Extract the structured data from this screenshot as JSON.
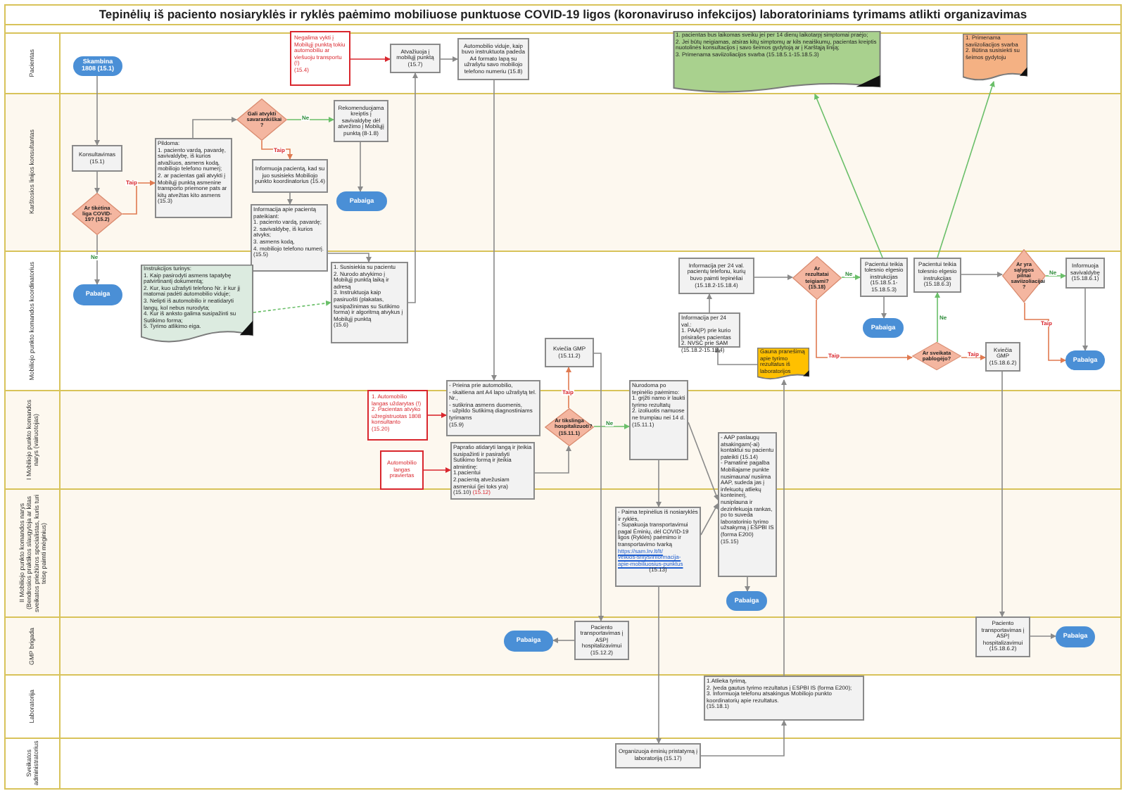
{
  "title": "Tepinėlių iš paciento nosiaryklės ir ryklės paėmimo mobiliuose punktuose COVID-19 ligos (koronaviruso infekcijos) laboratoriniams tyrimams atlikti organizavimas",
  "lanes": [
    {
      "label": "Pacientas"
    },
    {
      "label": "Karštosios linijos konsultantas"
    },
    {
      "label": "Mobiliojo punkto komandos koordinatorius"
    },
    {
      "label": "I Mobiliojo punkto komandos narys (vairuotojas)"
    },
    {
      "label": "II Mobiliojo punkto komandos narys (Bendrosios praktikos slaugytoja ar kitas sveikatos priežiūros specialistas, kuris turi teisę paimti mėginius)"
    },
    {
      "label": "GMP brigada"
    },
    {
      "label": "Laboratorija"
    },
    {
      "label": "Sveikatos administratorius"
    }
  ],
  "nodes": [
    {
      "kind": "start",
      "text": "Skambina 1808 (15.1)"
    },
    {
      "kind": "alert",
      "text": "Negalima vykti į Mobilųjį punktą tokiu automobiliu ar viešuoju transportu (!)\n(15.4)"
    },
    {
      "kind": "process",
      "text": "Atvažiuoja į mobilųjį punktą (15.7)"
    },
    {
      "kind": "process",
      "text": "Automobilio viduje, kaip buvo instruktuota padeda A4 formato lapą su užrašytu savo mobiliojo telefono numeriu (15.8)"
    },
    {
      "kind": "document",
      "color": "#a9d18e",
      "text": "1. pacientas bus laikomas sveiku jei per 14 dienų laikotarpį simptomai praėjo;\n2. Jei būtų neigiamas, atsiras kitų simptomų ar kils neaiškumų, pacientas kreiptis nuotolinės konsultacijos į savo šeimos gydytoją ar į Karštąją liniją;\n3. Primenama saviizoliacijos svarba (15.18.5.1-15.18.5.3)"
    },
    {
      "kind": "document",
      "color": "#f4b183",
      "text": "1. Primenama saviizoliacijos svarba\n2. Būtina susisiekti su šeimos gydytoju"
    },
    {
      "kind": "process",
      "text": "Konsultavimas (15.1)"
    },
    {
      "kind": "decision",
      "text": "Ar tikėtina liga COVID-19? (15.2)"
    },
    {
      "kind": "process",
      "text": "Pildoma:\n1. paciento vardą, pavardę, savivaldybę, iš kurios atvažiuos, asmens kodą, mobiliojo telefono numerį;\n2. ar pacientas gali atvykti į Mobilųjį punktą asmenine transporto priemone pats ar kitų atvežtas kito asmens\n(15.3)"
    },
    {
      "kind": "decision",
      "text": "Gali atvykti savarankiškai ?"
    },
    {
      "kind": "process",
      "text": "Rekomenduojama kreiptis į savivaldybę dėl atvežimo į Mobilųjį punktą (8-1.8)"
    },
    {
      "kind": "process",
      "text": "Informuoja pacientą, kad su juo susisieks Mobiliojo punkto koordinatorius (15.4)"
    },
    {
      "kind": "end",
      "text": "Pabaiga"
    },
    {
      "kind": "process",
      "text": "Informacija apie pacientą pateikiant:\n1. paciento vardą, pavardę;\n2. savivaldybę, iš kurios atvyks;\n3. asmens kodą,\n4. mobiliojo telefono numerį.\n(15.5)"
    },
    {
      "kind": "end",
      "text": "Pabaiga"
    },
    {
      "kind": "document",
      "color": "#dcebe0",
      "text": "Instrukcijos turinys:\n1. Kaip pasirodyti asmens tapatybę patvirtinantį dokumentą;\n2. Kur, kuo užrašyti telefono Nr. ir kur jį matomai padėti automobilio viduje;\n3. Nelipti iš automobilio ir neatidaryti langų, kol nebus nurodyta;\n4. Kur iš anksto galima susipažinti su Sutikimo forma;\n5. Tyrimo atlikimo eiga."
    },
    {
      "kind": "process",
      "text": "1. Susisiekia su pacientu\n2. Nurodo atvykimo į Mobilųjį punktą laiką ir adresą\n3. Instruktuoja kaip pasiruošti (plakatas, susipažinimas su Sutikimo forma) ir algoritmą atvykus į Mobilųjį punktą\n(15.6)"
    },
    {
      "kind": "process",
      "text": "Informacija per 24 val. pacientų telefonu, kurių buvo paimti tepinėliai (15.18.2-15.18.4)"
    },
    {
      "kind": "process",
      "text": "Informacija per 24 val.:\n1. PAA(P) prie kurio prisirašęs pacientas\n2. NVSC prie SAM\n(15.18.2-15.18.4)"
    },
    {
      "kind": "process",
      "text": "Kviečia GMP (15.11.2)"
    },
    {
      "kind": "decision",
      "text": "Ar rezultatai teigiami? (15.18)"
    },
    {
      "kind": "process",
      "text": "Pacientui teikia tolesnio elgesio instrukcijas (15.18.5.1-15.18.5.3)"
    },
    {
      "kind": "end",
      "text": "Pabaiga"
    },
    {
      "kind": "process",
      "text": "Pacientui teikia tolesnio elgesio instrukcijas (15.18.6.3)"
    },
    {
      "kind": "decision",
      "text": "Ar yra sąlygos pilnai saviizoliacijai ?"
    },
    {
      "kind": "process",
      "text": "Informuoja savivaldybę (15.18.6.1)"
    },
    {
      "kind": "document",
      "color": "#ffc000",
      "text": "Gauna pranešimą apie tyrimo rezultatus iš laboratorijos"
    },
    {
      "kind": "decision",
      "text": "Ar sveikata pablogėjo?"
    },
    {
      "kind": "process",
      "text": "Kviečia GMP (15.18.6.2)"
    },
    {
      "kind": "end",
      "text": "Pabaiga"
    },
    {
      "kind": "alert",
      "text": "1. Automobilio langas uždarytas (!)\n2. Pacientas atvyko užregistruotas 1808 konsultanto\n(15.20)"
    },
    {
      "kind": "alert",
      "text": "Automobilio langas praviertas"
    },
    {
      "kind": "process",
      "text": "- Prieina prie automobilio,\n- skaitiena ant A4 lapo užrašytą tel. Nr.,\n- sutikrina asmens duomenis,\n- užpildo Sutikimą diagnostiniams tyrimams\n(15.9)"
    },
    {
      "kind": "process",
      "text": "Paprašo atidaryti langą ir įteikia susipažinti ir pasirašyti Sutikimo formą ir įteikia atmintinę:\n1.pacientui\n2.pacientą atvežusiam asmeniui (jei toks yra)\n(15.10)",
      "red_suffix": "(15.12)"
    },
    {
      "kind": "decision",
      "text": "Ar tikslinga hospitalizuoti? (15.11.1)"
    },
    {
      "kind": "process",
      "text": "Nurodoma po tepinėlio paėmimo:\n1. grįžti namo ir laukti tyrimo rezultatų\n2. izoliuotis namuose ne trumpiau nei 14 d.\n(15.11.1)"
    },
    {
      "kind": "process",
      "text": "- AAP paslaugų atsakingam(-ai) kontaktui su pacientu pateikti (15.14)\n- Pamatinė pagalba Mobiliajame punkte nusimauna/ nusiima AAP, sudeda jas į infekuotų atliekų konteinerį, nusiplauna ir dezinfekuoja rankas, po to suveda laboratorinio tyrimo užsakymą į ESPBI IS (forma E200)\n(15.15)"
    },
    {
      "kind": "process",
      "text": "- Paima tepinėlius iš nosiaryklės ir ryklės,\n- Supakuoja transportavimui pagal Ėminių, dėl COVID-19 ligos (Ryklės) paėmimo ir transportavimo tvarką",
      "link_lines": [
        "https://sam.lrv.lt/lt/",
        "veiklos-sritys/informacija-",
        "apie-mobiliuosius-punktus"
      ],
      "after": "(15.13)"
    },
    {
      "kind": "end",
      "text": "Pabaiga"
    },
    {
      "kind": "end",
      "text": "Pabaiga"
    },
    {
      "kind": "process",
      "text": "Paciento transportavimas į ASPĮ hospitalizavimui (15.12.2)"
    },
    {
      "kind": "process",
      "text": "Paciento transportavimas į ASPĮ hospitalizavimui (15.18.6.2)"
    },
    {
      "kind": "end",
      "text": "Pabaiga"
    },
    {
      "kind": "process",
      "text": "1.Atlieka tyrimą,\n2. Įveda gautus tyrimo rezultatus į ESPBI IS (forma E200);\n3. Informuoja telefonu atsakingus Mobiliojo punkto koordinatorių apie rezultatus.\n(15.18.1)"
    },
    {
      "kind": "process",
      "text": "Organizuoja ėminių pristatymą į laboratoriją (15.17)"
    }
  ],
  "edge_labels": [
    {
      "text": "Taip",
      "kind": "yes"
    },
    {
      "text": "Ne",
      "kind": "no"
    },
    {
      "text": "Taip",
      "kind": "yes"
    },
    {
      "text": "Ne",
      "kind": "no"
    },
    {
      "text": "Taip",
      "kind": "yes"
    },
    {
      "text": "Ne",
      "kind": "no"
    },
    {
      "text": "Ne",
      "kind": "no"
    },
    {
      "text": "Taip",
      "kind": "yes"
    },
    {
      "text": "Ne",
      "kind": "no"
    },
    {
      "text": "Taip",
      "kind": "yes"
    },
    {
      "text": "Ne",
      "kind": "no"
    },
    {
      "text": "Taip",
      "kind": "yes"
    }
  ]
}
